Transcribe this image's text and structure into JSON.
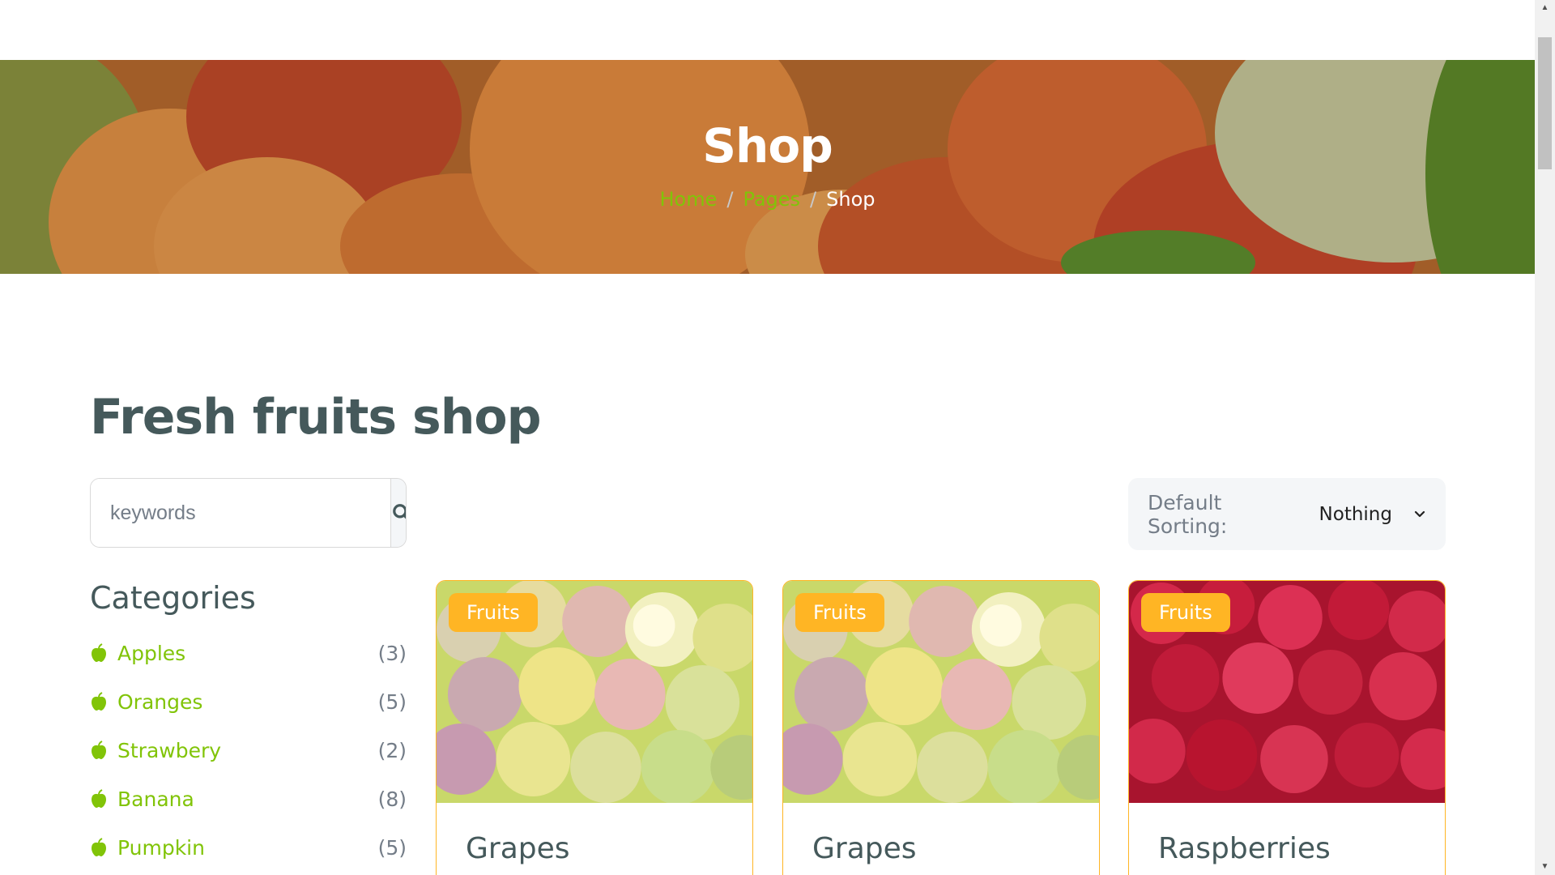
{
  "hero": {
    "title": "Shop",
    "breadcrumb": [
      {
        "label": "Home"
      },
      {
        "label": "Pages"
      },
      {
        "label": "Shop"
      }
    ]
  },
  "main": {
    "title": "Fresh fruits shop"
  },
  "search": {
    "placeholder": "keywords",
    "icon": "search-icon"
  },
  "sorting": {
    "label": "Default Sorting:",
    "selected": "Nothing"
  },
  "categories": {
    "title": "Categories",
    "items": [
      {
        "label": "Apples",
        "count": "(3)"
      },
      {
        "label": "Oranges",
        "count": "(5)"
      },
      {
        "label": "Strawbery",
        "count": "(2)"
      },
      {
        "label": "Banana",
        "count": "(8)"
      },
      {
        "label": "Pumpkin",
        "count": "(5)"
      }
    ]
  },
  "products": [
    {
      "badge": "Fruits",
      "name": "Grapes",
      "image": "grapes"
    },
    {
      "badge": "Fruits",
      "name": "Grapes",
      "image": "grapes"
    },
    {
      "badge": "Fruits",
      "name": "Raspberries",
      "image": "raspberries"
    }
  ],
  "colors": {
    "primary": "#81c408",
    "secondary": "#ffb524",
    "text": "#45595b",
    "muted": "#747d88"
  }
}
